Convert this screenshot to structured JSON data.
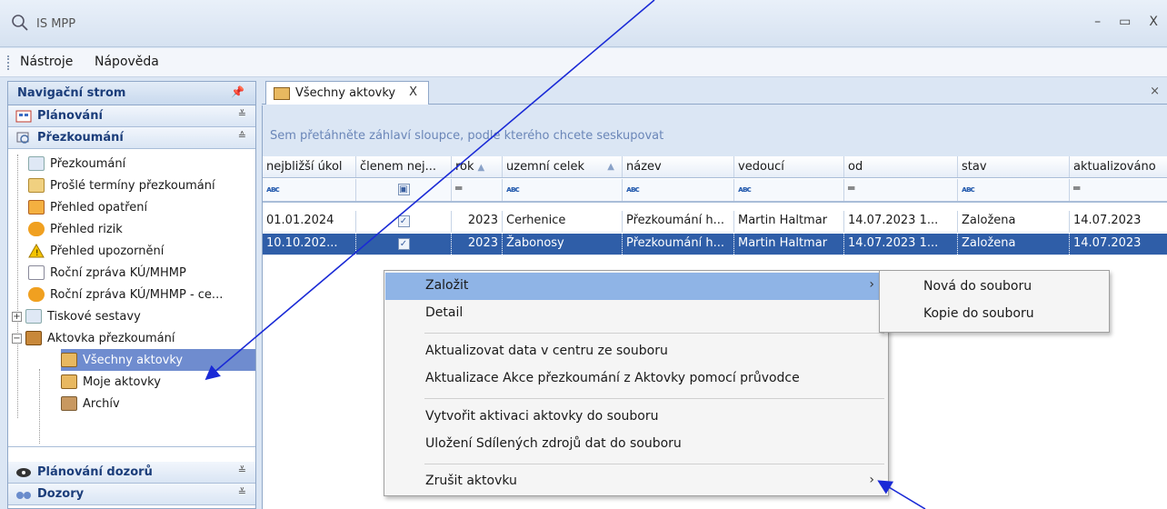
{
  "window": {
    "title": "IS MPP"
  },
  "menu": {
    "items": [
      "Nástroje",
      "Nápověda"
    ]
  },
  "nav": {
    "header": "Navigační strom",
    "pin": "ᵖ",
    "groups": {
      "planovani": "Plánování",
      "prezkoumani": "Přezkoumání",
      "planovani_dozoru": "Plánování dozorů",
      "dozory": "Dozory"
    },
    "tree": [
      "Přezkoumání",
      "Prošlé termíny přezkoumání",
      "Přehled opatření",
      "Přehled rizik",
      "Přehled upozornění",
      "Roční zpráva KÚ/MHMP",
      "Roční zpráva KÚ/MHMP - ce...",
      "Tiskové sestavy",
      "Aktovka přezkoumání",
      "Všechny aktovky",
      "Moje aktovky",
      "Archív"
    ]
  },
  "tab": {
    "label": "Všechny aktovky"
  },
  "grid": {
    "group_hint": "Sem přetáhněte záhlaví sloupce, podle kterého chcete seskupovat",
    "columns": [
      "nejbližší úkol",
      "členem nej...",
      "rok",
      "uzemní celek",
      "název",
      "vedoucí",
      "od",
      "stav",
      "aktualizováno"
    ],
    "rows": [
      [
        "01.01.2024",
        "",
        "2023",
        "Cerhenice",
        "Přezkoumání h...",
        "Martin Haltmar",
        "14.07.2023 1...",
        "Založena",
        "14.07.2023"
      ],
      [
        "10.10.202...",
        "",
        "2023",
        "Žabonosy",
        "Přezkoumání h...",
        "Martin Haltmar",
        "14.07.2023 1...",
        "Založena",
        "14.07.2023"
      ]
    ]
  },
  "context_menu": {
    "items": [
      "Založit",
      "Detail",
      "Aktualizovat data v centru ze souboru",
      "Aktualizace Akce přezkoumání z Aktovky pomocí průvodce",
      "Vytvořit aktivaci aktovky do souboru",
      "Uložení Sdílených zdrojů dat do souboru",
      "Zrušit aktovku"
    ],
    "submenu": [
      "Nová do souboru",
      "Kopie do souboru"
    ]
  }
}
